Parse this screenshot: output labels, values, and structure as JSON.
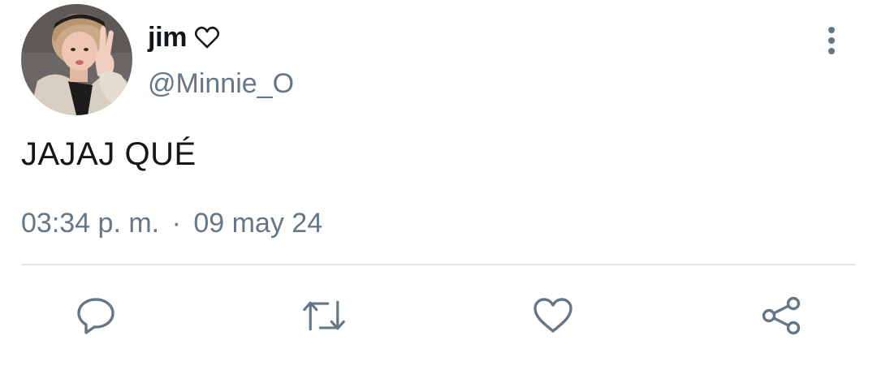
{
  "author": {
    "display_name": "jim",
    "name_emoji": "white-heart-outline",
    "handle": "@Minnie_O"
  },
  "tweet": {
    "text": "JAJAJ QUÉ",
    "time": "03:34 p. m.",
    "separator": "·",
    "date": "09 may 24"
  },
  "actions": [
    {
      "name": "reply",
      "icon": "speech-bubble-icon"
    },
    {
      "name": "retweet",
      "icon": "retweet-arrows-icon"
    },
    {
      "name": "like",
      "icon": "heart-icon"
    },
    {
      "name": "share",
      "icon": "share-nodes-icon"
    }
  ],
  "colors": {
    "text_primary": "#14171a",
    "text_secondary": "#657786",
    "icon": "#657786",
    "divider": "#e1e8ed",
    "background": "#ffffff"
  }
}
